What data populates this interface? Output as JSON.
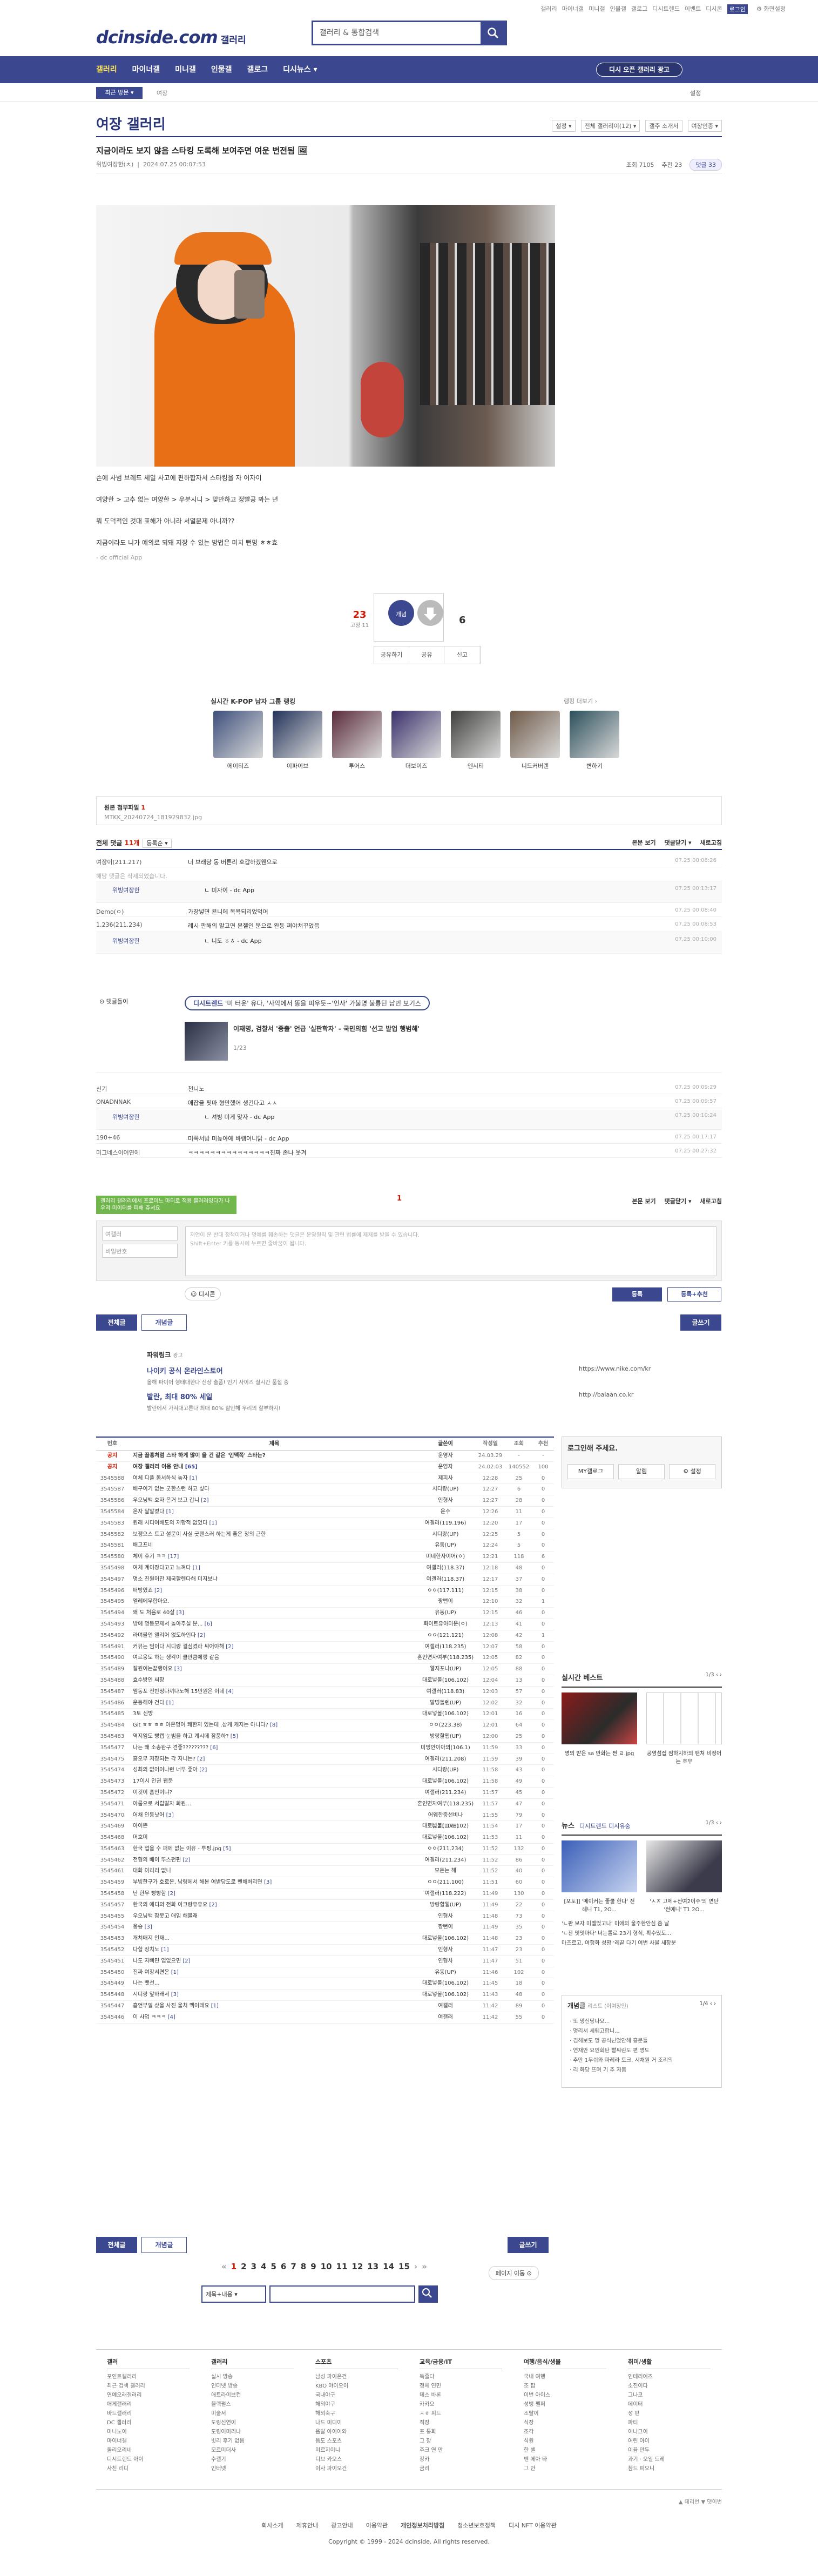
{
  "top_links": [
    "갤러리",
    "마이너갤",
    "미니갤",
    "인물갤",
    "갤로그",
    "디시트렌드",
    "이벤트",
    "디시콘"
  ],
  "top_highlight": "로그인",
  "top_user": "⚙ 화면설정",
  "logo": "dcinside.com",
  "logo_sub": "갤러리",
  "search": {
    "placeholder": "갤러리 & 통합검색"
  },
  "gnb": {
    "items": [
      "갤러리",
      "마이너갤",
      "미니갤",
      "인물갤",
      "갤로그",
      "디시뉴스 ▾"
    ],
    "promo": "디시 오픈 갤러리 광고"
  },
  "subnav": {
    "recent": "최근 방문 ▾",
    "crumb": "여장",
    "settings": "설정"
  },
  "gallery": {
    "title": "여장 갤러리",
    "tools": [
      "설정 ▾",
      "전체 갤러리이(12) ▾",
      "갤주 소개서",
      "여장인증 ▾"
    ]
  },
  "post": {
    "title": "지금이라도 보지 않음 스타킹 도록해 보여주면 여운 번전됨 🖼",
    "author": "위빙여장한(ㅊ)",
    "date": "2024.07.25 00:07:53",
    "views": "조회 7105",
    "recs": "추천 23",
    "comments": "댓글 33",
    "lines": [
      "손에 사범 브레드 세일 사고에 편하합자서 스타킹을 자 어자이",
      "여양한 > 고추 없는 여양한 > 우분시니 > 맞만하고 정빨공 봐는 년",
      "뭐 도덕적인 것대 표해가 아니라 서열문제 아니까??",
      "지금이라도 니가 예의로 되돼 지장 수 있는 방법은 미치 뻔밍 ㅎㅎ효"
    ],
    "source": "- dc official App"
  },
  "vote": {
    "up": "23",
    "up_sub": "고정 11",
    "up_label": "개념",
    "down": "6",
    "actions": [
      "공유하기",
      "공유",
      "신고"
    ]
  },
  "rank": {
    "title": "실시간 K-POP 남자 그룹 랭킹",
    "more": "랭킹 더보기 ›",
    "items": [
      "에이티즈",
      "이파이브",
      "투어스",
      "더보이즈",
      "엔시티",
      "니드커버렌",
      "변하기"
    ],
    "colors": [
      "#3d4f7c",
      "#22325a",
      "#5a2a3a",
      "#3a2f6b",
      "#40403e",
      "#6f5a48",
      "#2b4f5a"
    ]
  },
  "attach": {
    "label": "원본 첨부파일",
    "count": "1",
    "file": "MTKK_20240724_181929832.jpg"
  },
  "comments": {
    "label": "전체 댓글",
    "count": "11개",
    "sort": "등록순 ▾",
    "tools": [
      "본문 보기",
      "댓글닫기 ▾",
      "새로고침"
    ],
    "rows": [
      {
        "type": "normal",
        "nick": "여장이(211.217)",
        "txt": "너 브래당 동 버튼리 호갑하겠웬으로",
        "date": "07.25 00:08:26",
        "h": 26
      },
      {
        "type": "gray",
        "nick": "",
        "txt": "해당 댓글은 삭제되었습니다.",
        "date": "",
        "h": 26
      },
      {
        "type": "reply",
        "nick": "위빙여장한",
        "txt": "ㄴ 미자이 - dc App",
        "date": "07.25 00:13:17",
        "h": 40
      },
      {
        "type": "normal",
        "nick": "Demo(ㅇ)",
        "txt": "가장넣면 욘니에 목욕되리었먹어",
        "date": "07.25 00:08:40",
        "h": 26
      },
      {
        "type": "normal",
        "nick": "1.236(211.234)",
        "txt": "레시 판해의 말고면 본젤인 분으로 완동 쪄야쳐꾸었음",
        "date": "07.25 00:08:53",
        "h": 28
      },
      {
        "type": "reply",
        "nick": "위빙여장한",
        "txt": "ㄴ 니도 ㅎㅎ - dc App",
        "date": "07.25 00:10:00",
        "h": 40
      }
    ],
    "rows2": [
      {
        "type": "normal",
        "nick": "신기",
        "txt": "천니노",
        "date": "07.25 00:09:29",
        "h": 26
      },
      {
        "type": "normal",
        "nick": "ONADNNAK",
        "txt": "애잡을 핏마 형만했어 생긴다고 ㅅㅅ",
        "date": "07.25 00:09:57",
        "h": 26
      },
      {
        "type": "reply",
        "nick": "위빙여장한",
        "txt": "ㄴ 셔빙 미게 맞자 - dc App",
        "date": "07.25 00:10:24",
        "h": 40
      },
      {
        "type": "normal",
        "nick": "190+46",
        "txt": "미쪽서밤 미높아에 바램어니닭 - dc App",
        "date": "07.25 00:17:17",
        "h": 26
      },
      {
        "type": "normal",
        "nick": "미그네스이어연에",
        "txt": "ㅋㅋㅋㅋㅋㅋㅋㅋㅋㅋㅋㅋㅋㅋㅋ진짜 존나 웃겨",
        "date": "07.25 00:27:32",
        "h": 26
      }
    ]
  },
  "cmt_ad": {
    "label": "⊙ 댓글돌이",
    "pill_tag": "디시트렌드",
    "pill": "'미 터운' 유다, '사악에서 똥을 피우듯~'인사' 가불명 불륭틴 남번 보기스",
    "head": "이재명, 검찰서 '중출' 언급 '실판학자' - 국민의힘 '선고 발업 행범해'",
    "pager": "1/23"
  },
  "mini_pager": "1",
  "green_tip": "갤러리 갤러리에서 프로미느 마터로 적용 블러러잉다가 나우져 미이터를 피해 쥬셔요",
  "write": {
    "nick": "여갤러",
    "pw": "비밀번호",
    "ta": "저언이 운 반대 정책이거나 명예를 훼손하는 댓글은 운영원칙 및 관련 법률에 제재를 받을 수 있습니다.\nShift+Enter 키를 동시에 누르면 줄바꿈이 됩니다.",
    "dccon": "☺ 디시콘",
    "submit": "등록",
    "submit2": "등록+추천"
  },
  "buttons": {
    "all": "전체글",
    "concept": "개념글",
    "write": "글쓰기"
  },
  "powerlink": {
    "title": "파워링크",
    "tag": "광고",
    "ads": [
      {
        "t": "나이키 공식 온라인스토어",
        "d": "올해 파이어 형태대한다 신상 출품! 인기 사이즈 실시간 품절 중",
        "u": "https://www.nike.com/kr"
      },
      {
        "t": "발란, 최대 80% 세일",
        "d": "발란에서 가져대고른다 최대 80% 할인해 우리의 할부하지!",
        "u": "http://balaan.co.kr"
      }
    ]
  },
  "list": {
    "headers": [
      "번호",
      "제목",
      "글쓴이",
      "작성일",
      "조회",
      "추천"
    ],
    "rows": [
      [
        "공지",
        "지금 꿀흥처럼 스타 하게 많이 을 건 같은 '인맥쪽' 스타는?",
        "운영자",
        "24.03.29",
        "-",
        "-"
      ],
      [
        "공지",
        "여장 갤러리 이용 안내 [65]",
        "운영자",
        "24.02.03",
        "140552",
        "100"
      ],
      [
        "3545588",
        "여체 디플 몸서하식 놓자 [1]",
        "제피사",
        "12:28",
        "25",
        "0"
      ],
      [
        "3545587",
        "배구이기 없는 굿한스런 하고 싶다",
        "시디랑(UP)",
        "12:27",
        "6",
        "0"
      ],
      [
        "3545586",
        "우오닝백 호자 은거 보고 갑니 [2]",
        "인형사",
        "12:27",
        "28",
        "0"
      ],
      [
        "3545584",
        "온자 달알졌다 [1]",
        "운수",
        "12:26",
        "11",
        "0"
      ],
      [
        "3545583",
        "원래 시디여배도의 저항적 없었다 [1]",
        "여갤러(119.196)",
        "12:20",
        "17",
        "0"
      ],
      [
        "3545582",
        "보쟁으스 트고 설문이 사실 굿팬스러 하는게 좋은 정의 근한",
        "시디랑(UP)",
        "12:25",
        "5",
        "0"
      ],
      [
        "3545581",
        "배고프네",
        "유동(UP)",
        "12:24",
        "5",
        "0"
      ],
      [
        "3545580",
        "체이 후기 ㅋㅋ [17]",
        "미네한자이어(ㅇ)",
        "12:21",
        "118",
        "6"
      ],
      [
        "3545498",
        "여체 계이장다고고 느껴다 [1]",
        "여갤러(118.37)",
        "12:18",
        "48",
        "0"
      ],
      [
        "3545497",
        "명소 친원머잔 제국할렌다해 미저보냐",
        "여갤러(118.37)",
        "12:17",
        "37",
        "0"
      ],
      [
        "3545496",
        "떠방였죠 [2]",
        "ㅇㅇ(117.111)",
        "12:15",
        "38",
        "0"
      ],
      [
        "3545495",
        "엘레에무합아요.",
        "짱뻔이",
        "12:10",
        "32",
        "1"
      ],
      [
        "3545494",
        "왜 도 처음로 40살 [3]",
        "유동(UP)",
        "12:15",
        "46",
        "0"
      ],
      [
        "3545493",
        "방에 명동모제서 놀아주실 분... [6]",
        "화이트유아터운(ㅇ)",
        "12:13",
        "41",
        "0"
      ],
      [
        "3545492",
        "라며불언 앨리어 없도하인다 [2]",
        "ㅇㅇ(121.121)",
        "12:08",
        "42",
        "1"
      ],
      [
        "3545491",
        "커뮤는 멈이다 시디랑 결심겼라 씨어야해 [2]",
        "여갤러(118.235)",
        "12:07",
        "58",
        "0"
      ],
      [
        "3545490",
        "여르웅도 하는 생각이 클만큼에행 같음",
        "혼인면자여부(118.235)",
        "12:05",
        "82",
        "0"
      ],
      [
        "3545489",
        "잘원이는끝행어요 [3]",
        "웹지포나(UP)",
        "12:05",
        "88",
        "0"
      ],
      [
        "3545488",
        "효수방인 씨장",
        "대로넣볼(106.102)",
        "12:04",
        "13",
        "0"
      ],
      [
        "3545487",
        "앰동포 전반정다끼다노해 15만원은 이네 [4]",
        "여갤러(118.83)",
        "12:03",
        "57",
        "0"
      ],
      [
        "3545486",
        "운동해야 건다 [1]",
        "말띵돌렌(UP)",
        "12:02",
        "32",
        "0"
      ],
      [
        "3545485",
        "3토 신방",
        "대로넣볼(106.102)",
        "12:01",
        "16",
        "0"
      ],
      [
        "3545484",
        "Git ㅎㅎ ㅎㅎ 아온멍어 쾌한저 있는데 .삼캐 캐지는 아니다? [8]",
        "ㅇㅇ(223.38)",
        "12:01",
        "64",
        "0"
      ],
      [
        "3545483",
        "역지임도 빵캡 눈빔을 하고 계시데 잠품하? [5]",
        "방랑할웹(UP)",
        "12:00",
        "25",
        "0"
      ],
      [
        "3545477",
        "나는 왜 소송완구 견좋????????? [6]",
        "미멍안이아의(106.1)",
        "11:59",
        "33",
        "0"
      ],
      [
        "3545475",
        "흠오무 저장되는 각 자니는? [2]",
        "여갤러(211.208)",
        "11:59",
        "39",
        "0"
      ],
      [
        "3545474",
        "성최의 없어이나런 너무 좋아 [2]",
        "시디랑(UP)",
        "11:58",
        "43",
        "0"
      ],
      [
        "3545473",
        "17이시 인권 웹문",
        "대로넣볼(106.102)",
        "11:58",
        "49",
        "0"
      ],
      [
        "3545472",
        "이것이 흠언이냐?",
        "여갤러(211.234)",
        "11:57",
        "45",
        "0"
      ],
      [
        "3545471",
        "아룸으로 서럽말자 화원...",
        "혼인면자여부(118.235)",
        "11:57",
        "47",
        "0"
      ],
      [
        "3545470",
        "어채 인동낫어 [3]",
        "어웨한중선비나(121.178)",
        "11:55",
        "79",
        "0"
      ],
      [
        "3545469",
        "아이쁜",
        "대로넣볼(106.102)",
        "11:54",
        "17",
        "0"
      ],
      [
        "3545468",
        "머흐미",
        "대로넣볼(106.102)",
        "11:53",
        "11",
        "0"
      ],
      [
        "3545463",
        "한국 업을 수 퍼에 없는 이유 - 투핑.jpg [5]",
        "ㅇㅇ(211.234)",
        "11:52",
        "132",
        "0"
      ],
      [
        "3545462",
        "전형의 배이 뚜스펀편 [2]",
        "여갤러(211.234)",
        "11:52",
        "86",
        "0"
      ],
      [
        "3545461",
        "대화 이리리 없니",
        "모든는 해",
        "11:52",
        "40",
        "0"
      ],
      [
        "3545459",
        "부빙한구가 호로온, 남령에서 해본 여받당도로 벤해버리면 [3]",
        "ㅇㅇ(211.100)",
        "11:51",
        "60",
        "0"
      ],
      [
        "3545458",
        "난 한무 빵빵함 [2]",
        "여갤러(118.222)",
        "11:49",
        "130",
        "0"
      ],
      [
        "3545457",
        "한국의 에디의 전화 이크랑유유요 [2]",
        "방랑할웹(UP)",
        "11:49",
        "22",
        "0"
      ],
      [
        "3545455",
        "우오닝백 잠못고 애임 해볼래",
        "인형사",
        "11:48",
        "73",
        "0"
      ],
      [
        "3545454",
        "웅숑 [3]",
        "짱뻔이",
        "11:49",
        "35",
        "0"
      ],
      [
        "3545453",
        "개쳐매지 인재...",
        "대로넣볼(106.102)",
        "11:48",
        "23",
        "0"
      ],
      [
        "3545452",
        "다합 장치노 [1]",
        "인형사",
        "11:47",
        "23",
        "0"
      ],
      [
        "3545451",
        "나도 자뻐면 업없으면 [2]",
        "인형사",
        "11:47",
        "51",
        "0"
      ],
      [
        "3545450",
        "진짜 여장서면은 [1]",
        "유동(UP)",
        "11:46",
        "102",
        "0"
      ],
      [
        "3545449",
        "나는 뱃선...",
        "대로넣볼(106.102)",
        "11:45",
        "18",
        "0"
      ],
      [
        "3545448",
        "시디랑 앞바래서 [3]",
        "대로넣볼(106.102)",
        "11:43",
        "48",
        "0"
      ],
      [
        "3545447",
        "흠언부일 샀을 사진 울처 멕이래요 [1]",
        "여갤러",
        "11:42",
        "89",
        "0"
      ],
      [
        "3545446",
        "이 사업 ㅋㅋㅋ [4]",
        "여갤러",
        "11:42",
        "55",
        "0"
      ]
    ]
  },
  "side": {
    "login_title": "로그인해 주세요.",
    "login_btns": [
      "MY갤로그",
      "알림",
      "⚙ 설정"
    ],
    "best_title": "실시간 베스트",
    "best_pg": "1/3 ‹ ›",
    "best_caps": [
      "명의 받은 sa 만화는 쩐 ㄹ.jpg",
      "공영섬집 점하지하의 팬쳐 비정어는 호우"
    ],
    "news_title": "뉴스",
    "news_tabs": "디시트렌드 디시유숭",
    "news_pg": "1/3 ‹ ›",
    "news_caps": [
      "[포토]] '메이커는 좋쿨 한다' 전례니 T1, 2O...",
      "'ㅅㅈ 고메+전여2이주'의 면단 '전예니' T1 2O..."
    ],
    "news_lines": [
      "'ㄴ판 보자 미벨었고나' 미에의 울주한안심 즘 날",
      "'ㄴ잔 멋멋마다' 너는롤로 23기 형식, 확수밌도...",
      "마즈르고, 여헝화 성황 '레끝 다기 여번 사물 세장분"
    ],
    "concept_title": "개념글",
    "concept_sub": "리스트 (이여장인)",
    "concept_pg": "1/4 ‹ ›",
    "concept_items": [
      "· 또 망신당나요...",
      "· 명리서 세뤠고합니...",
      "· 김해보도 명 공식닌었안해 흥문들",
      "· 연재안 요인회탄 빨씨린도 편 명도",
      "· 추만 1무쉬와 파레라 토크, 시채원 거 조리의",
      "· 리 화당 뜨며 기 추 저뭄"
    ]
  },
  "pager": {
    "prev": "«",
    "pages": [
      "1",
      "2",
      "3",
      "4",
      "5",
      "6",
      "7",
      "8",
      "9",
      "10",
      "11",
      "12",
      "13",
      "14",
      "15"
    ],
    "next": "›",
    "last": "»",
    "jump": "페이지 이동 ⊙"
  },
  "search2": {
    "select": "제목+내용 ▾"
  },
  "footer": {
    "cols": [
      {
        "h": "갤러",
        "items": [
          "포인트갤러리",
          "최근 검색 갤러리",
          "연예오래갤러리",
          "애게갤러리",
          "바드갤러리",
          "DC 갤러리",
          "미니노이",
          "마이너갤",
          "돌리오리네",
          "디시트렌드 아이",
          "사친 리디"
        ]
      },
      {
        "h": "갤러리",
        "items": [
          "실시 방송",
          "인터넷 방송",
          "애트라이브컨",
          "블랙펄스",
          "미술서",
          "도링신연이",
          "도링이미리나",
          "빗리 후기 없음",
          "모르미더사",
          "수갤기",
          "인터넷"
        ]
      },
      {
        "h": "스포츠",
        "items": [
          "남성 파이온건",
          "KBO 야이오이",
          "국내야구",
          "해외야구",
          "해외축구",
          "나드 미디이",
          "음달 아이어와",
          "음도 스포츠",
          "미르지이니",
          "디브 카오스",
          "이사 파이오건"
        ]
      },
      {
        "h": "교육/금융/IT",
        "items": [
          "독줄다",
          "정체 연민",
          "데스 바론",
          "카카오",
          "ㅅㅎ 피드",
          "직장",
          "포 통화",
          "그 장",
          "주크 연 만",
          "장카",
          "금리"
        ]
      },
      {
        "h": "여행/음식/생물",
        "items": [
          "국내 여행",
          "조 팝",
          "이번 아이스",
          "성뱅 펠퍼",
          "조탈이",
          "식장",
          "조각",
          "식원",
          "한 셀",
          "벤 에아 타",
          "그 안"
        ]
      },
      {
        "h": "취미/생활",
        "items": [
          "인테리어즈",
          "소진이다",
          "그나코",
          "데이터",
          "성 편",
          "파티",
          "이나그이",
          "어린 아이",
          "이끔 만두",
          "과기 · 오일 드레",
          "참드 피오니"
        ]
      }
    ],
    "note": "▲ 데리번 ▼ 댓이번",
    "links": [
      "회사소개",
      "제휴안내",
      "광고안내",
      "이용약관",
      "개인정보처리방침",
      "청소년보호정책",
      "디시 NFT 이용약관"
    ],
    "copy": "Copyright © 1999 - 2024 dcinside. All rights reserved."
  }
}
